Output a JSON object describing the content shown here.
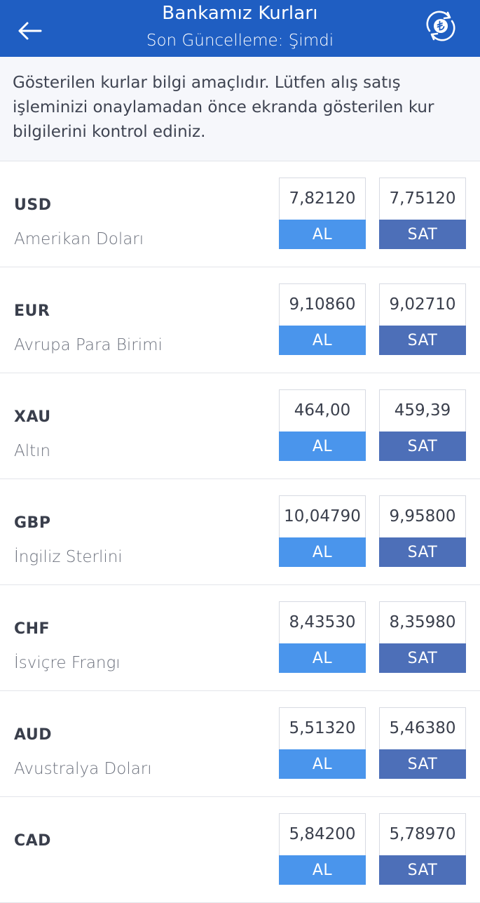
{
  "header": {
    "title": "Bankamız Kurları",
    "subtitle": "Son Güncelleme: Şimdi",
    "back_icon": "arrow-left-icon",
    "refresh_icon": "lira-refresh-icon",
    "background_color": "#1f5ec2"
  },
  "notice": {
    "text": "Gösterilen kurlar bilgi amaçlıdır. Lütfen alış satış işleminizi onaylamadan önce ekranda gösterilen kur bilgilerini kontrol ediniz."
  },
  "colors": {
    "buy": "#4a95ec",
    "sell": "#4d6fb8"
  },
  "currencies": [
    {
      "code": "USD",
      "name": "Amerikan Doları",
      "buy": "7,82120",
      "buy_label": "AL",
      "sell": "7,75120",
      "sell_label": "SAT"
    },
    {
      "code": "EUR",
      "name": "Avrupa Para Birimi",
      "buy": "9,10860",
      "buy_label": "AL",
      "sell": "9,02710",
      "sell_label": "SAT"
    },
    {
      "code": "XAU",
      "name": "Altın",
      "buy": "464,00",
      "buy_label": "AL",
      "sell": "459,39",
      "sell_label": "SAT"
    },
    {
      "code": "GBP",
      "name": "İngiliz Sterlini",
      "buy": "10,04790",
      "buy_label": "AL",
      "sell": "9,95800",
      "sell_label": "SAT"
    },
    {
      "code": "CHF",
      "name": "İsviçre Frangı",
      "buy": "8,43530",
      "buy_label": "AL",
      "sell": "8,35980",
      "sell_label": "SAT"
    },
    {
      "code": "AUD",
      "name": "Avustralya Doları",
      "buy": "5,51320",
      "buy_label": "AL",
      "sell": "5,46380",
      "sell_label": "SAT"
    },
    {
      "code": "CAD",
      "name": "",
      "buy": "5,84200",
      "buy_label": "AL",
      "sell": "5,78970",
      "sell_label": "SAT"
    }
  ]
}
